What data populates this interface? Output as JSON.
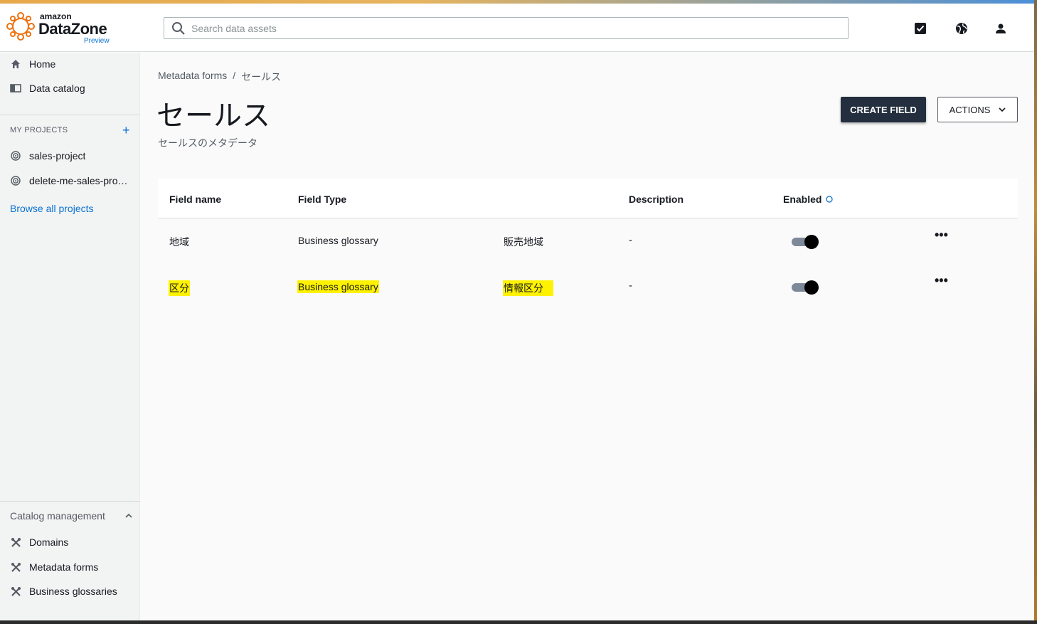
{
  "header": {
    "logo_small": "amazon",
    "logo_big": "DataZone",
    "logo_badge": "Preview",
    "search_placeholder": "Search data assets",
    "icons": [
      "tasks-icon",
      "globe-icon",
      "user-icon"
    ]
  },
  "sidebar": {
    "nav": [
      {
        "label": "Home",
        "icon": "home-icon"
      },
      {
        "label": "Data catalog",
        "icon": "book-icon"
      }
    ],
    "my_projects_title": "MY PROJECTS",
    "projects": [
      {
        "label": "sales-project",
        "icon": "project-icon"
      },
      {
        "label": "delete-me-sales-project",
        "icon": "project-icon"
      }
    ],
    "browse_link": "Browse all projects",
    "catalog_group": "Catalog management",
    "catalog_items": [
      {
        "label": "Domains",
        "icon": "tools-icon"
      },
      {
        "label": "Metadata forms",
        "icon": "tools-icon"
      },
      {
        "label": "Business glossaries",
        "icon": "tools-icon"
      }
    ]
  },
  "main": {
    "breadcrumb": [
      "Metadata forms",
      "セールス"
    ],
    "breadcrumb_sep": "/",
    "title": "セールス",
    "subtitle": "セールスのメタデータ",
    "create_button": "CREATE FIELD",
    "actions_button": "ACTIONS",
    "columns": {
      "field_name": "Field name",
      "field_type": "Field Type",
      "description": "Description",
      "enabled": "Enabled"
    },
    "rows": [
      {
        "name": "地域",
        "type": "Business glossary",
        "glossary": "販売地域",
        "description": "-",
        "enabled": true,
        "highlighted": false
      },
      {
        "name": "区分",
        "type": "Business glossary",
        "glossary": "情報区分",
        "description": "-",
        "enabled": true,
        "highlighted": true
      }
    ],
    "more_symbol": "•••"
  },
  "colors": {
    "accent_link": "#0972d3",
    "primary_button": "#232f3e",
    "highlight": "#fff200",
    "logo": "#ec7211"
  }
}
